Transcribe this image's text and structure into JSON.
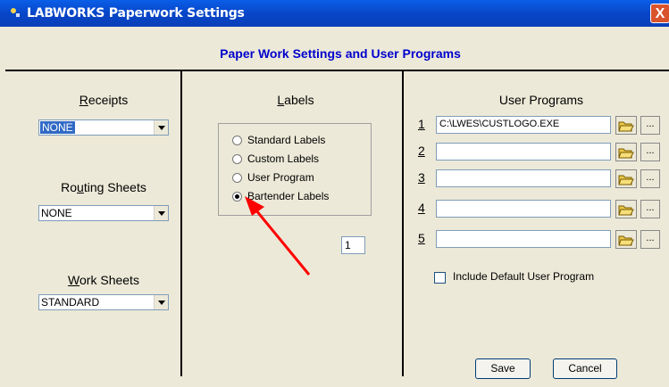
{
  "window": {
    "title": "LABWORKS Paperwork Settings",
    "close_label": "X"
  },
  "header": {
    "title": "Paper Work Settings and User Programs"
  },
  "left": {
    "receipts": {
      "label": "Receipts",
      "value": "NONE"
    },
    "routing": {
      "label": "Routing Sheets",
      "value": "NONE"
    },
    "work": {
      "label": "Work Sheets",
      "value": "STANDARD"
    }
  },
  "labels": {
    "title": "Labels",
    "options": [
      {
        "label": "Standard Labels",
        "selected": false
      },
      {
        "label": "Custom Labels",
        "selected": false
      },
      {
        "label": "User Program",
        "selected": false
      },
      {
        "label": "Bartender Labels",
        "selected": true
      }
    ],
    "copies": "1"
  },
  "user_programs": {
    "title": "User Programs",
    "rows": [
      {
        "num": "1",
        "value": "C:\\LWES\\CUSTLOGO.EXE"
      },
      {
        "num": "2",
        "value": ""
      },
      {
        "num": "3",
        "value": ""
      },
      {
        "num": "4",
        "value": ""
      },
      {
        "num": "5",
        "value": ""
      }
    ],
    "browse_label": "...",
    "include_default_label": "Include Default User Program",
    "include_default_checked": false
  },
  "buttons": {
    "save": "Save",
    "cancel": "Cancel"
  },
  "annotation": {
    "arrow_color": "#ff0000"
  }
}
